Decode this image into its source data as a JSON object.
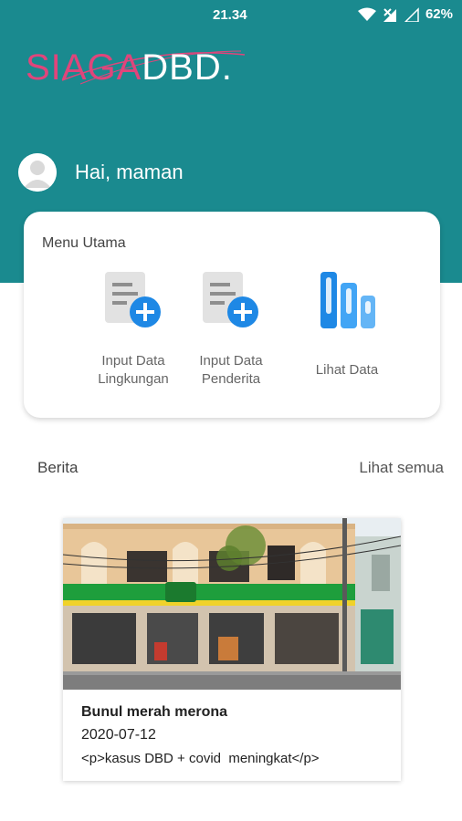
{
  "status_bar": {
    "time": "21.34",
    "battery": "62%",
    "icons": [
      "wifi-icon",
      "signal-off-icon",
      "signal-icon",
      "battery-icon"
    ]
  },
  "logo": {
    "part1": "SIAGA",
    "part2": "DBD.",
    "colors": {
      "part1": "#e0457b",
      "part2": "#ffffff"
    }
  },
  "greeting": {
    "text": "Hai, maman"
  },
  "menu": {
    "title": "Menu Utama",
    "items": [
      {
        "label_line1": "Input Data",
        "label_line2": "Lingkungan",
        "icon": "add-document-icon"
      },
      {
        "label_line1": "Input Data",
        "label_line2": "Penderita",
        "icon": "add-document-icon"
      },
      {
        "label_line1": "Lihat Data",
        "label_line2": "",
        "icon": "bar-chart-icon"
      }
    ]
  },
  "news_section": {
    "title": "Berita",
    "see_all": "Lihat semua"
  },
  "news": [
    {
      "title": "Bunul merah merona",
      "date": "2020-07-12",
      "body": "<p>kasus DBD + covid  meningkat</p>"
    }
  ],
  "colors": {
    "header": "#1a8a8f",
    "accent_blue": "#1e88e5",
    "brand_pink": "#e0457b"
  }
}
